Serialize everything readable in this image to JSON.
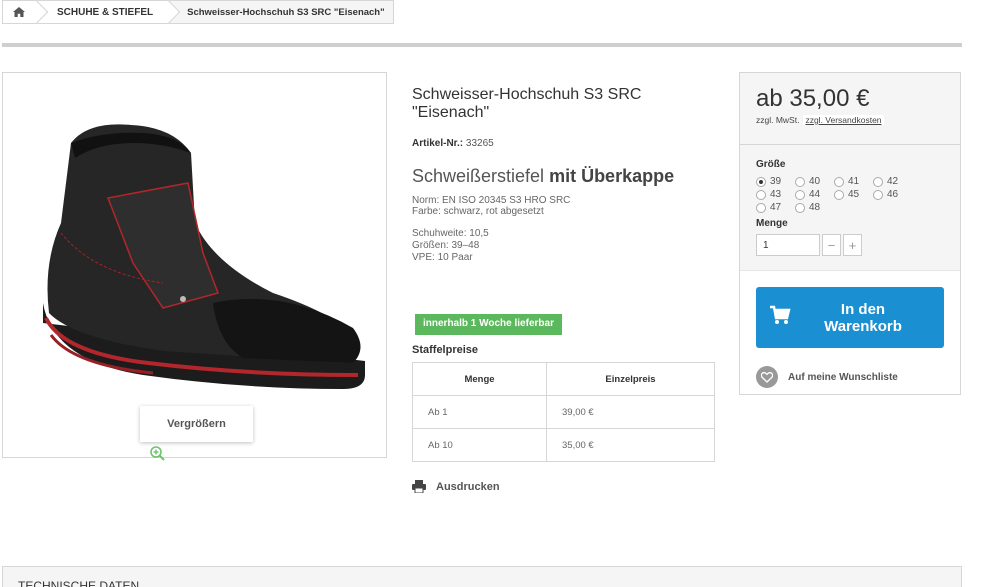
{
  "breadcrumb": {
    "category": "SCHUHE & STIEFEL",
    "current": "Schweisser-Hochschuh S3 SRC \"Eisenach\""
  },
  "gallery": {
    "zoom_label": "Vergrößern"
  },
  "product": {
    "title": "Schweisser-Hochschuh S3 SRC \"Eisenach\"",
    "artnr_label": "Artikel-Nr.:",
    "artnr_value": "33265",
    "subhead_plain": "Schweißerstiefel",
    "subhead_bold": "mit Überkappe",
    "norm": "Norm: EN ISO 20345 S3 HRO SRC",
    "farbe": "Farbe: schwarz, rot abgesetzt",
    "schuhweite": "Schuhweite: 10,5",
    "groessen": "Größen: 39–48",
    "vpe": "VPE: 10 Paar",
    "availability": "innerhalb 1 Woche lieferbar"
  },
  "staffel": {
    "title": "Staffelpreise",
    "headers": [
      "Menge",
      "Einzelpreis"
    ],
    "rows": [
      {
        "menge": "Ab 1",
        "preis": "39,00 €"
      },
      {
        "menge": "Ab 10",
        "preis": "35,00 €"
      }
    ]
  },
  "print_label": "Ausdrucken",
  "buy": {
    "price": "ab 35,00 €",
    "tax": "zzgl. MwSt.",
    "shipping": "zzgl. Versandkosten",
    "size_label": "Größe",
    "sizes": [
      "39",
      "40",
      "41",
      "42",
      "43",
      "44",
      "45",
      "46",
      "47",
      "48"
    ],
    "selected_size": "39",
    "qty_label": "Menge",
    "qty_value": "1",
    "minus": "−",
    "plus": "+",
    "cart_label_1": "In den",
    "cart_label_2": "Warenkorb",
    "wishlist": "Auf meine Wunschliste"
  },
  "tech_heading": "TECHNISCHE DATEN",
  "colors": {
    "accent": "#1a8fd1",
    "availability": "#5cb85c"
  },
  "icons": {
    "home": "home-icon",
    "zoom": "magnifier-plus-icon",
    "print": "printer-icon",
    "cart": "cart-icon",
    "heart": "heart-icon"
  }
}
